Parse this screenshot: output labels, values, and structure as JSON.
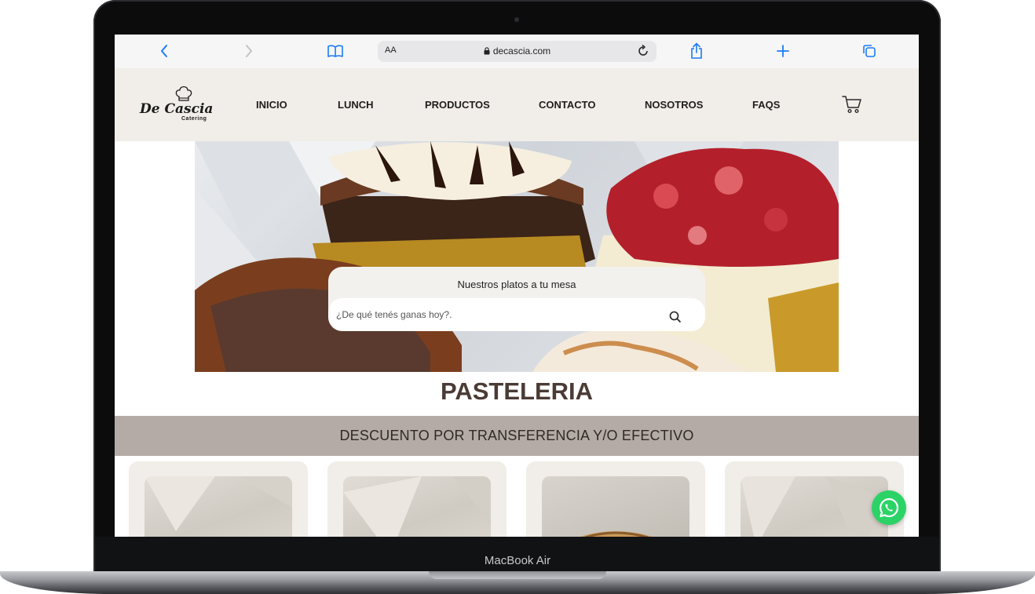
{
  "device": {
    "label": "MacBook Air"
  },
  "browser": {
    "url": "decascia.com",
    "text_size_label": "AA",
    "icons": [
      "back-icon",
      "forward-icon",
      "bookmarks-icon",
      "lock-icon",
      "reload-icon",
      "share-icon",
      "new-tab-icon",
      "tabs-icon"
    ]
  },
  "site": {
    "logo": {
      "name": "De Cascia",
      "sub": "Catering",
      "icon": "chef-hat-icon"
    },
    "nav": [
      {
        "label": "INICIO"
      },
      {
        "label": "LUNCH"
      },
      {
        "label": "PRODUCTOS"
      },
      {
        "label": "CONTACTO"
      },
      {
        "label": "NOSOTROS"
      },
      {
        "label": "FAQS"
      }
    ],
    "cart_icon": "cart-icon"
  },
  "hero": {
    "title": "Nuestros platos a tu mesa",
    "search_placeholder": "¿De qué tenés ganas hoy?.",
    "search_icon": "search-icon"
  },
  "page": {
    "title": "PASTELERIA",
    "promo": "DESCUENTO POR TRANSFERENCIA Y/O EFECTIVO"
  },
  "whatsapp_icon": "whatsapp-icon",
  "colors": {
    "header_bg": "#f1ede8",
    "promo_bg": "#b5aba6",
    "title": "#4a3b34",
    "whatsapp": "#2bd366",
    "link_blue": "#1a7cf5"
  }
}
